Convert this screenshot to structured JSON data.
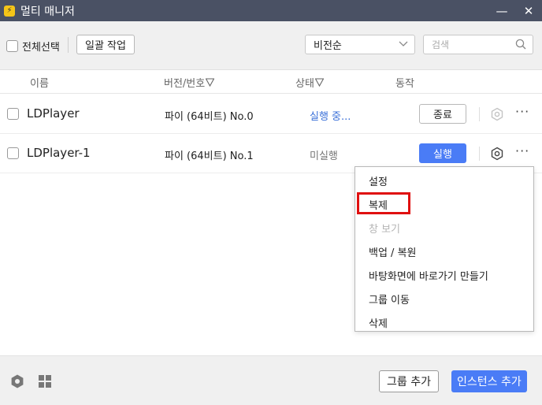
{
  "window": {
    "title": "멀티 매니저",
    "icon": "lightning-app-icon",
    "minimize_glyph": "—",
    "close_glyph": "✕"
  },
  "toolbar": {
    "select_all_label": "전체선택",
    "batch_label": "일괄 작업",
    "sort_value": "비전순",
    "search_placeholder": "검색"
  },
  "columns": {
    "name": "이름",
    "version": "버전/번호",
    "status": "상태",
    "action": "동작"
  },
  "rows": [
    {
      "name": "LDPlayer",
      "version": "파이 (64비트)  No.0",
      "status": "실행 중...",
      "action": "종료"
    },
    {
      "name": "LDPlayer-1",
      "version": "파이 (64비트)  No.1",
      "status": "미실행",
      "action": "실행"
    }
  ],
  "more_glyph": "···",
  "context_menu": {
    "items": [
      {
        "label": "설정",
        "enabled": true
      },
      {
        "label": "복제",
        "enabled": true,
        "highlighted": true
      },
      {
        "label": "창 보기",
        "enabled": false
      },
      {
        "label": "백업 / 복원",
        "enabled": true
      },
      {
        "label": "바탕화면에 바로가기 만들기",
        "enabled": true
      },
      {
        "label": "그룹 이동",
        "enabled": true
      },
      {
        "label": "삭제",
        "enabled": true
      }
    ]
  },
  "footer": {
    "group_add_label": "그룹 추가",
    "instance_add_label": "인스턴스 추가"
  },
  "colors": {
    "titlebar": "#4a5164",
    "accent": "#4a7cf6",
    "running_text": "#3a6fd8",
    "highlight": "#e01010"
  }
}
